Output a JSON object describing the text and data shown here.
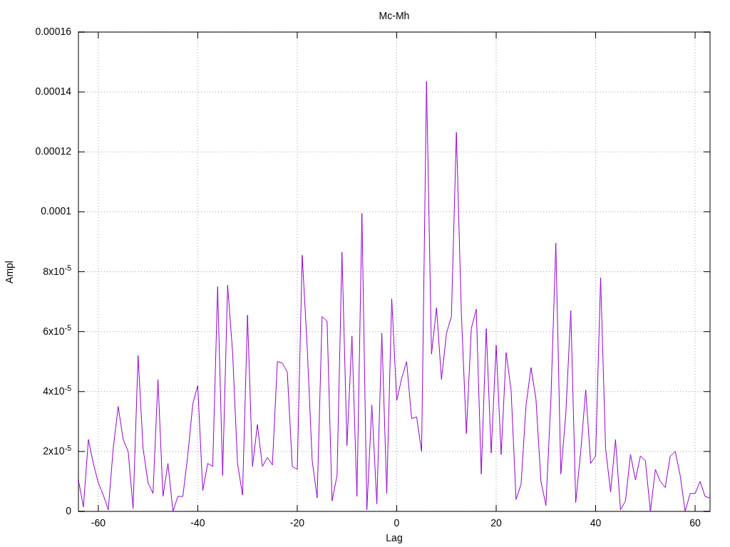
{
  "chart_data": {
    "type": "line",
    "title": "Mc-Mh",
    "xlabel": "Lag",
    "ylabel": "Ampl",
    "x": [
      -64,
      -63,
      -62,
      -61,
      -60,
      -59,
      -58,
      -57,
      -56,
      -55,
      -54,
      -53,
      -52,
      -51,
      -50,
      -49,
      -48,
      -47,
      -46,
      -45,
      -44,
      -43,
      -42,
      -41,
      -40,
      -39,
      -38,
      -37,
      -36,
      -35,
      -34,
      -33,
      -32,
      -31,
      -30,
      -29,
      -28,
      -27,
      -26,
      -25,
      -24,
      -23,
      -22,
      -21,
      -20,
      -19,
      -18,
      -17,
      -16,
      -15,
      -14,
      -13,
      -12,
      -11,
      -10,
      -9,
      -8,
      -7,
      -6,
      -5,
      -4,
      -3,
      -2,
      -1,
      0,
      1,
      2,
      3,
      4,
      5,
      6,
      7,
      8,
      9,
      10,
      11,
      12,
      13,
      14,
      15,
      16,
      17,
      18,
      19,
      20,
      21,
      22,
      23,
      24,
      25,
      26,
      27,
      28,
      29,
      30,
      31,
      32,
      33,
      34,
      35,
      36,
      37,
      38,
      39,
      40,
      41,
      42,
      43,
      44,
      45,
      46,
      47,
      48,
      49,
      50,
      51,
      52,
      53,
      54,
      55,
      56,
      57,
      58,
      59,
      60,
      61,
      62,
      63
    ],
    "grid": true,
    "series": [
      {
        "color": "#9400d3",
        "values": [
          1.05e-05,
          1.5e-06,
          2.4e-05,
          1.6e-05,
          9.5e-06,
          5.5e-06,
          5e-07,
          2.1e-05,
          3.5e-05,
          2.4e-05,
          2e-05,
          1e-06,
          5.2e-05,
          2.1e-05,
          9.5e-06,
          6e-06,
          4.4e-05,
          5e-06,
          1.6e-05,
          0,
          5e-06,
          5e-06,
          1.9e-05,
          3.6e-05,
          4.2e-05,
          7e-06,
          1.6e-05,
          1.5e-05,
          7.5e-05,
          1.2e-05,
          7.55e-05,
          5.3e-05,
          1.6e-05,
          5.5e-06,
          6.55e-05,
          1.5e-05,
          2.9e-05,
          1.5e-05,
          1.8e-05,
          1.55e-05,
          5e-05,
          4.95e-05,
          4.65e-05,
          1.5e-05,
          1.4e-05,
          8.55e-05,
          5.5e-05,
          1.7e-05,
          4.5e-06,
          6.5e-05,
          6.35e-05,
          3.5e-06,
          1.2e-05,
          8.65e-05,
          2.2e-05,
          5.85e-05,
          5e-06,
          9.95e-05,
          5e-07,
          3.55e-05,
          2.5e-06,
          5.95e-05,
          6e-06,
          7.1e-05,
          3.7e-05,
          4.45e-05,
          5e-05,
          3.1e-05,
          3.15e-05,
          2e-05,
          0.0001435,
          5.25e-05,
          6.8e-05,
          4.4e-05,
          5.95e-05,
          6.5e-05,
          0.0001265,
          6.6e-05,
          2.6e-05,
          6.1e-05,
          6.75e-05,
          1.25e-05,
          6.1e-05,
          1.95e-05,
          5.55e-05,
          1.9e-05,
          5.3e-05,
          4.05e-05,
          4e-06,
          9e-06,
          3.55e-05,
          4.8e-05,
          3.75e-05,
          1e-05,
          2e-06,
          3.75e-05,
          8.95e-05,
          1.25e-05,
          3.25e-05,
          6.7e-05,
          3e-06,
          2e-05,
          4.05e-05,
          1.6e-05,
          1.85e-05,
          7.8e-05,
          2.1e-05,
          6.5e-06,
          2.4e-05,
          5e-07,
          3.5e-06,
          1.9e-05,
          1.05e-05,
          1.85e-05,
          1.7e-05,
          0,
          1.4e-05,
          1e-05,
          8e-06,
          1.85e-05,
          2e-05,
          1.2e-05,
          0,
          6e-06,
          6e-06,
          1e-05,
          5e-06,
          4.5e-06
        ]
      }
    ],
    "xlim": [
      -64,
      63
    ],
    "ylim": [
      0,
      0.00016
    ],
    "xticks": [
      -60,
      -40,
      -20,
      0,
      20,
      40,
      60
    ],
    "yticks": [
      {
        "value": 0,
        "label": "0"
      },
      {
        "value": 2e-05,
        "label": "2x10$^{-5}$"
      },
      {
        "value": 4e-05,
        "label": "4x10$^{-5}$"
      },
      {
        "value": 6e-05,
        "label": "6x10$^{-5}$"
      },
      {
        "value": 8e-05,
        "label": "8x10$^{-5}$"
      },
      {
        "value": 0.0001,
        "label": "0.0001"
      },
      {
        "value": 0.00012,
        "label": "0.00012"
      },
      {
        "value": 0.00014,
        "label": "0.00014"
      },
      {
        "value": 0.00016,
        "label": "0.00016"
      }
    ]
  }
}
